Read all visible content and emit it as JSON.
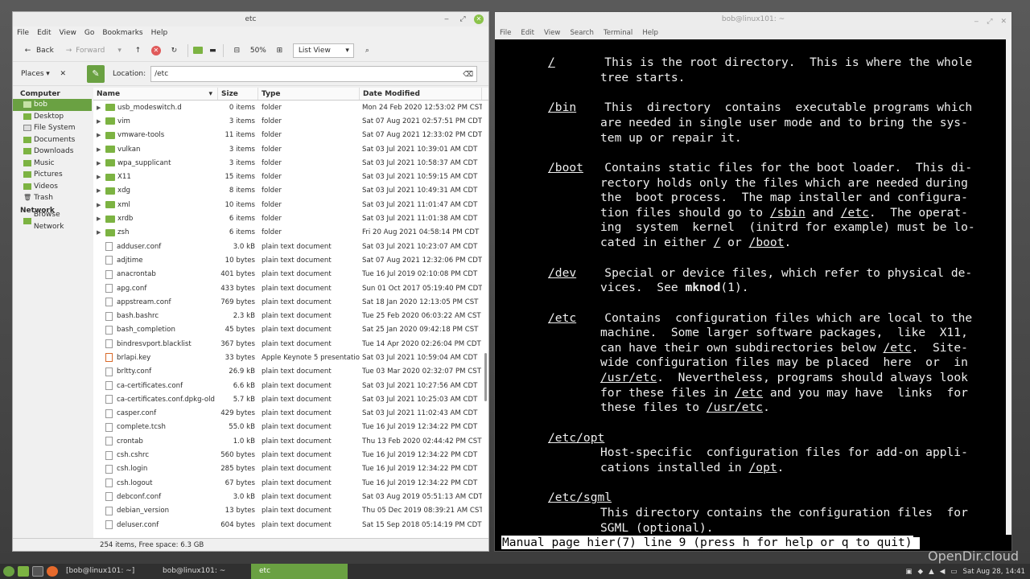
{
  "fm": {
    "title": "etc",
    "menu": [
      "File",
      "Edit",
      "View",
      "Go",
      "Bookmarks",
      "Help"
    ],
    "back": "Back",
    "forward": "Forward",
    "zoom": "50%",
    "view": "List View",
    "places": "Places",
    "location_label": "Location:",
    "location": "/etc",
    "cols": {
      "name": "Name",
      "size": "Size",
      "type": "Type",
      "date": "Date Modified"
    },
    "sidebar": {
      "computer": "Computer",
      "computer_items": [
        "bob",
        "Desktop",
        "File System",
        "Documents",
        "Downloads",
        "Music",
        "Pictures",
        "Videos",
        "Trash"
      ],
      "network": "Network",
      "network_items": [
        "Browse Network"
      ]
    },
    "rows": [
      {
        "name": "usb_modeswitch.d",
        "size": "0 items",
        "type": "folder",
        "date": "Mon 24 Feb 2020 12:53:02 PM CST",
        "dir": true
      },
      {
        "name": "vim",
        "size": "3 items",
        "type": "folder",
        "date": "Sat 07 Aug 2021 02:57:51 PM CDT",
        "dir": true
      },
      {
        "name": "vmware-tools",
        "size": "11 items",
        "type": "folder",
        "date": "Sat 07 Aug 2021 12:33:02 PM CDT",
        "dir": true
      },
      {
        "name": "vulkan",
        "size": "3 items",
        "type": "folder",
        "date": "Sat 03 Jul 2021 10:39:01 AM CDT",
        "dir": true
      },
      {
        "name": "wpa_supplicant",
        "size": "3 items",
        "type": "folder",
        "date": "Sat 03 Jul 2021 10:58:37 AM CDT",
        "dir": true
      },
      {
        "name": "X11",
        "size": "15 items",
        "type": "folder",
        "date": "Sat 03 Jul 2021 10:59:15 AM CDT",
        "dir": true
      },
      {
        "name": "xdg",
        "size": "8 items",
        "type": "folder",
        "date": "Sat 03 Jul 2021 10:49:31 AM CDT",
        "dir": true
      },
      {
        "name": "xml",
        "size": "10 items",
        "type": "folder",
        "date": "Sat 03 Jul 2021 11:01:47 AM CDT",
        "dir": true
      },
      {
        "name": "xrdb",
        "size": "6 items",
        "type": "folder",
        "date": "Sat 03 Jul 2021 11:01:38 AM CDT",
        "dir": true
      },
      {
        "name": "zsh",
        "size": "6 items",
        "type": "folder",
        "date": "Fri 20 Aug 2021 04:58:14 PM CDT",
        "dir": true
      },
      {
        "name": "adduser.conf",
        "size": "3.0 kB",
        "type": "plain text document",
        "date": "Sat 03 Jul 2021 10:23:07 AM CDT"
      },
      {
        "name": "adjtime",
        "size": "10 bytes",
        "type": "plain text document",
        "date": "Sat 07 Aug 2021 12:32:06 PM CDT"
      },
      {
        "name": "anacrontab",
        "size": "401 bytes",
        "type": "plain text document",
        "date": "Tue 16 Jul 2019 02:10:08 PM CDT"
      },
      {
        "name": "apg.conf",
        "size": "433 bytes",
        "type": "plain text document",
        "date": "Sun 01 Oct 2017 05:19:40 PM CDT"
      },
      {
        "name": "appstream.conf",
        "size": "769 bytes",
        "type": "plain text document",
        "date": "Sat 18 Jan 2020 12:13:05 PM CST"
      },
      {
        "name": "bash.bashrc",
        "size": "2.3 kB",
        "type": "plain text document",
        "date": "Tue 25 Feb 2020 06:03:22 AM CST"
      },
      {
        "name": "bash_completion",
        "size": "45 bytes",
        "type": "plain text document",
        "date": "Sat 25 Jan 2020 09:42:18 PM CST"
      },
      {
        "name": "bindresvport.blacklist",
        "size": "367 bytes",
        "type": "plain text document",
        "date": "Tue 14 Apr 2020 02:26:04 PM CDT"
      },
      {
        "name": "brlapi.key",
        "size": "33 bytes",
        "type": "Apple Keynote 5 presentation",
        "date": "Sat 03 Jul 2021 10:59:04 AM CDT",
        "key": true
      },
      {
        "name": "brltty.conf",
        "size": "26.9 kB",
        "type": "plain text document",
        "date": "Tue 03 Mar 2020 02:32:07 PM CST"
      },
      {
        "name": "ca-certificates.conf",
        "size": "6.6 kB",
        "type": "plain text document",
        "date": "Sat 03 Jul 2021 10:27:56 AM CDT"
      },
      {
        "name": "ca-certificates.conf.dpkg-old",
        "size": "5.7 kB",
        "type": "plain text document",
        "date": "Sat 03 Jul 2021 10:25:03 AM CDT"
      },
      {
        "name": "casper.conf",
        "size": "429 bytes",
        "type": "plain text document",
        "date": "Sat 03 Jul 2021 11:02:43 AM CDT"
      },
      {
        "name": "complete.tcsh",
        "size": "55.0 kB",
        "type": "plain text document",
        "date": "Tue 16 Jul 2019 12:34:22 PM CDT"
      },
      {
        "name": "crontab",
        "size": "1.0 kB",
        "type": "plain text document",
        "date": "Thu 13 Feb 2020 02:44:42 PM CST"
      },
      {
        "name": "csh.cshrc",
        "size": "560 bytes",
        "type": "plain text document",
        "date": "Tue 16 Jul 2019 12:34:22 PM CDT"
      },
      {
        "name": "csh.login",
        "size": "285 bytes",
        "type": "plain text document",
        "date": "Tue 16 Jul 2019 12:34:22 PM CDT"
      },
      {
        "name": "csh.logout",
        "size": "67 bytes",
        "type": "plain text document",
        "date": "Tue 16 Jul 2019 12:34:22 PM CDT"
      },
      {
        "name": "debconf.conf",
        "size": "3.0 kB",
        "type": "plain text document",
        "date": "Sat 03 Aug 2019 05:51:13 AM CDT"
      },
      {
        "name": "debian_version",
        "size": "13 bytes",
        "type": "plain text document",
        "date": "Thu 05 Dec 2019 08:39:21 AM CST"
      },
      {
        "name": "deluser.conf",
        "size": "604 bytes",
        "type": "plain text document",
        "date": "Sat 15 Sep 2018 05:14:19 PM CDT"
      }
    ],
    "status": "254 items, Free space: 6.3 GB"
  },
  "term": {
    "title": "bob@linux101: ~",
    "menu": [
      "File",
      "Edit",
      "View",
      "Search",
      "Terminal",
      "Help"
    ],
    "status": "Manual page hier(7) line 9 (press h for help or q to quit)"
  },
  "panel": {
    "tasks": [
      "[bob@linux101: ~]",
      "bob@linux101: ~",
      "etc"
    ],
    "clock": "Sat Aug 28, 14:41"
  },
  "watermark": "OpenDir.cloud"
}
